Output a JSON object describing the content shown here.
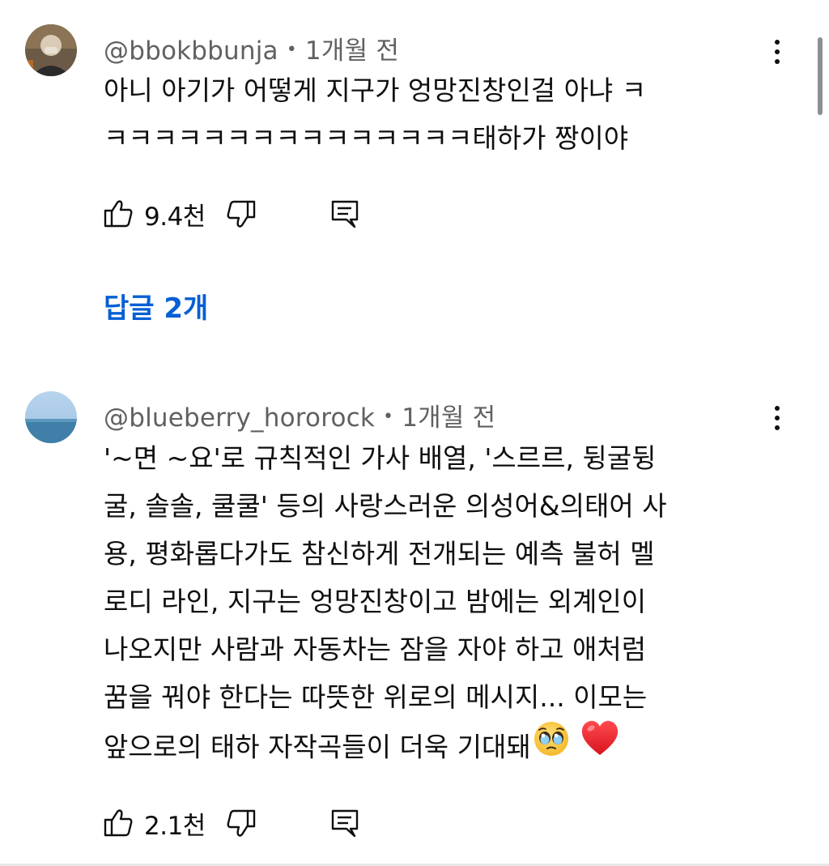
{
  "comments": [
    {
      "author": "@bbokbbunja",
      "separator": "•",
      "time": "1개월 전",
      "lines": [
        "아니 아기가 어떻게 지구가 엉망진창인걸 아냐 ㅋ",
        "ㅋㅋㅋㅋㅋㅋㅋㅋㅋㅋㅋㅋㅋㅋㅋ태하가 짱이야"
      ],
      "likes": "9.4천",
      "replies_label": "답글 2개",
      "icons": [
        "thumbs-up-icon",
        "thumbs-down-icon",
        "comment-icon",
        "more-vert-icon"
      ]
    },
    {
      "author": "@blueberry_hororock",
      "separator": "•",
      "time": "1개월 전",
      "lines": [
        "'~면 ~요'로 규칙적인 가사 배열, '스르르, 뒹굴뒹",
        "굴, 솔솔, 쿨쿨' 등의 사랑스러운 의성어&의태어 사",
        "용, 평화롭다가도 참신하게 전개되는 예측 불허 멜",
        "로디 라인, 지구는 엉망진창이고 밤에는 외계인이",
        "나오지만 사람과 자동차는 잠을 자야 하고 애처럼",
        "꿈을 꿔야 한다는 따뜻한 위로의 메시지... 이모는",
        "앞으로의 태하 자작곡들이 더욱 기대돼"
      ],
      "emojis": [
        "🥹",
        "❤️"
      ],
      "likes": "2.1천",
      "icons": [
        "thumbs-up-icon",
        "thumbs-down-icon",
        "comment-icon",
        "more-vert-icon"
      ]
    }
  ],
  "colors": {
    "text": "#0f0f0f",
    "meta": "#606060",
    "link": "#065fd4",
    "scrollbar": "#8e8e8e",
    "heart": "#e0262d"
  }
}
